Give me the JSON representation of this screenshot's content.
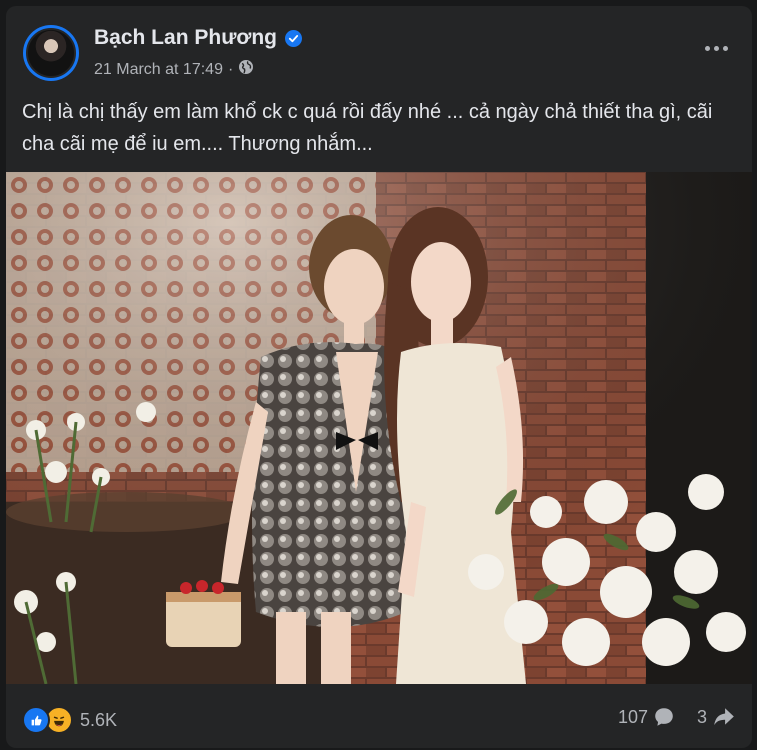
{
  "post": {
    "author_name": "Bạch Lan Phương",
    "verified": true,
    "timestamp": "21 March at 17:49",
    "separator": "·",
    "audience_icon": "globe-icon",
    "more_icon": "more-horizontal-icon",
    "text": "Chị là chị thấy em làm khổ ck c quá rồi đấy nhé ... cả ngày chả thiết tha gì, cãi cha cãi mẹ để iu em.... Thương nhắm...",
    "photo_icon": "photo-image"
  },
  "footer": {
    "reactions": [
      "like-icon",
      "haha-icon"
    ],
    "reaction_count": "5.6K",
    "comment_count": "107",
    "comment_icon": "comment-icon",
    "share_count": "3",
    "share_icon": "share-icon"
  },
  "colors": {
    "background": "#18191a",
    "card": "#242526",
    "primary_text": "#e4e6eb",
    "secondary_text": "#b0b3b8",
    "accent": "#1877f2"
  }
}
